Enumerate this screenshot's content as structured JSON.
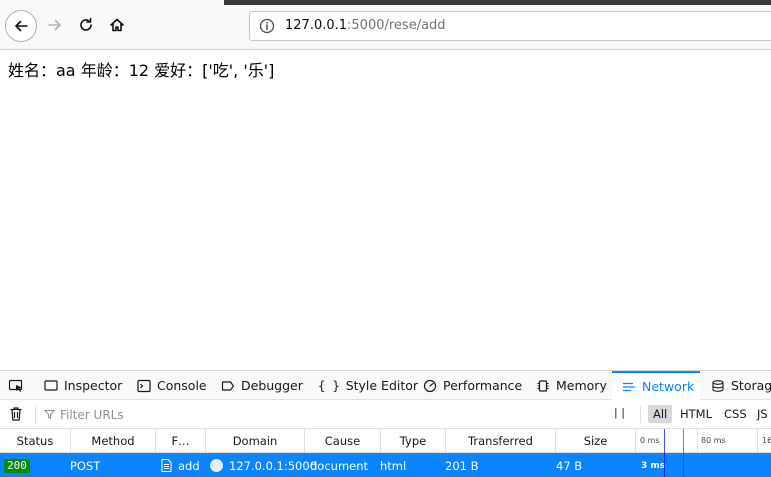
{
  "browser": {
    "url_host": "127.0.0.1",
    "url_rest": ":5000/rese/add"
  },
  "page": {
    "text": "姓名：aa 年龄：12 爱好：['吃', '乐']"
  },
  "devtools": {
    "tabs": [
      "Inspector",
      "Console",
      "Debugger",
      "Style Editor",
      "Performance",
      "Memory",
      "Network",
      "Storage"
    ],
    "selected_tab": "Network",
    "filter_placeholder": "Filter URLs",
    "pause_label": "| |",
    "type_filters": [
      "All",
      "HTML",
      "CSS",
      "JS"
    ],
    "active_type_filter": "All",
    "columns": [
      "Status",
      "Method",
      "F…",
      "Domain",
      "Cause",
      "Type",
      "Transferred",
      "Size"
    ],
    "waterfall_labels": [
      "0 ms",
      "80 ms",
      "16"
    ],
    "row": {
      "status": "200",
      "method": "POST",
      "file": "add",
      "domain": "127.0.0.1:5000",
      "cause": "document",
      "type": "html",
      "transferred": "201 B",
      "size": "47 B",
      "timing": "3 ms"
    }
  },
  "colors": {
    "accent": "#0a84ff",
    "status_ok": "#058b00"
  }
}
